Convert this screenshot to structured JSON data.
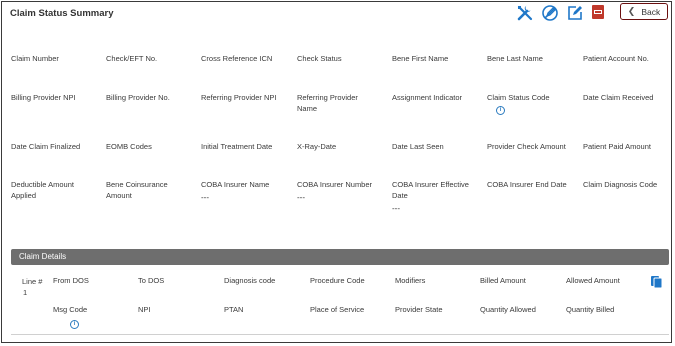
{
  "page": {
    "title": "Claim Status Summary"
  },
  "toolbar": {
    "back_label": "Back",
    "icons": [
      "tools-icon",
      "no-edit-icon",
      "edit-icon",
      "pdf-icon"
    ],
    "colors": {
      "primary_icon": "#1f77c8",
      "pdf": "#c0392b",
      "back_border": "#6b0f0f"
    }
  },
  "summary": {
    "row1": [
      "Claim Number",
      "Check/EFT No.",
      "Cross Reference ICN",
      "Check Status",
      "Bene First Name",
      "Bene Last Name",
      "Patient Account No."
    ],
    "row2": [
      "Billing Provider NPI",
      "Billing Provider No.",
      "Referring Provider NPI",
      "Referring Provider Name",
      "Assignment Indicator",
      "Claim Status Code",
      "Date Claim Received"
    ],
    "row3": [
      "Date Claim Finalized",
      "EOMB Codes",
      "Initial Treatment Date",
      "X-Ray-Date",
      "Date Last Seen",
      "Provider Check Amount",
      "Patient Paid Amount"
    ],
    "row4": [
      "Deductible Amount Applied",
      "Bene Coinsurance Amount",
      "COBA Insurer Name",
      "COBA Insurer Number",
      "COBA Insurer Effective Date",
      "COBA Insurer End Date",
      "Claim Diagnosis Code"
    ],
    "values": {
      "coba_name": "---",
      "coba_number": "---",
      "coba_effective": "---"
    }
  },
  "details": {
    "header": "Claim Details",
    "line_label": "Line #",
    "line_value": "1",
    "row1": [
      "From DOS",
      "To DOS",
      "Diagnosis code",
      "Procedure Code",
      "Modifiers",
      "Billed Amount",
      "Allowed Amount"
    ],
    "row2": [
      "Msg Code",
      "NPI",
      "PTAN",
      "Place of Service",
      "Provider State",
      "Quantity Allowed",
      "Quantity Billed"
    ]
  }
}
